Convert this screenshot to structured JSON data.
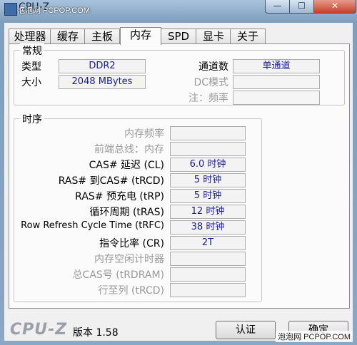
{
  "window": {
    "title": "CPU-Z",
    "watermark_top": "泡泡网 PCPOP.COM",
    "watermark_bottom": "泡泡网 PCPOP.COM",
    "buttons": {
      "minimize": "—",
      "maximize": "☐",
      "close": "✕"
    }
  },
  "tabs": [
    "处理器",
    "缓存",
    "主板",
    "内存",
    "SPD",
    "显卡",
    "关于"
  ],
  "active_tab": "内存",
  "general": {
    "title": "常规",
    "type_label": "类型",
    "type_value": "DDR2",
    "size_label": "大小",
    "size_value": "2048 MBytes",
    "channel_label": "通道数",
    "channel_value": "单通道",
    "dc_label": "DC模式",
    "dc_value": "",
    "note_label": "注：频率",
    "note_value": ""
  },
  "timings": {
    "title": "时序",
    "rows": [
      {
        "label": "内存频率",
        "value": "",
        "dim": true
      },
      {
        "label": "前端总线：内存",
        "value": "",
        "dim": true
      },
      {
        "label": "CAS# 延迟 (CL)",
        "value": "6.0 时钟",
        "dim": false
      },
      {
        "label": "RAS# 到CAS# (tRCD)",
        "value": "5 时钟",
        "dim": false
      },
      {
        "label": "RAS# 预充电 (tRP)",
        "value": "5 时钟",
        "dim": false
      },
      {
        "label": "循环周期 (tRAS)",
        "value": "12 时钟",
        "dim": false
      },
      {
        "label": "Row Refresh Cycle Time (tRFC)",
        "value": "38 时钟",
        "dim": false
      },
      {
        "label": "指令比率 (CR)",
        "value": "2T",
        "dim": false
      },
      {
        "label": "内存空闲计时器",
        "value": "",
        "dim": true
      },
      {
        "label": "总CAS号 (tRDRAM)",
        "value": "",
        "dim": true
      },
      {
        "label": "行至列 (tRCD)",
        "value": "",
        "dim": true
      }
    ]
  },
  "footer": {
    "logo": "CPU-Z",
    "version": "版本 1.58",
    "validate_label": "认证",
    "ok_label": "确定"
  },
  "colors": {
    "value_text": "#1a1aa0",
    "dim_text": "#9a9a9a"
  }
}
